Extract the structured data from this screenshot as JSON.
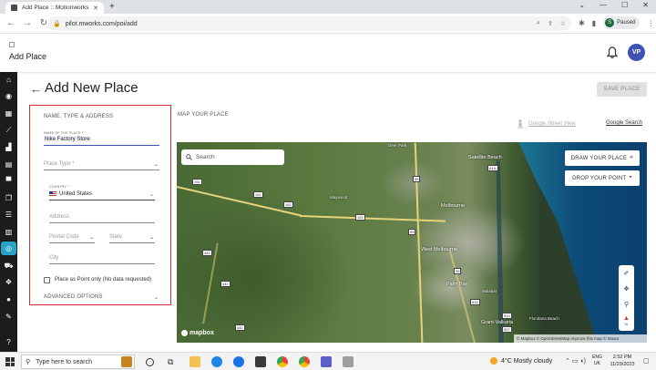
{
  "browser": {
    "tab_title": "Add Place :: Motionworks",
    "tab_close": "✕",
    "new_tab": "+",
    "url": "pilot.mworks.com/poi/add",
    "profile_initial": "S",
    "profile_status": "Paused"
  },
  "app": {
    "header_title": "Add Place",
    "avatar_initials": "VP"
  },
  "page": {
    "title": "Add New Place",
    "save_button": "SAVE PLACE"
  },
  "form": {
    "section_title": "NAME, TYPE & ADDRESS",
    "name_label": "NAME OF THE PLACE *",
    "name_value": "Nike Factory Store",
    "place_type_placeholder": "Place Type *",
    "country_label": "COUNTRY *",
    "country_value": "United States",
    "address_placeholder": "Address",
    "postal_code_placeholder": "Postal Code",
    "state_placeholder": "State",
    "city_placeholder": "City",
    "point_only_label": "Place as Point only (No data requested)",
    "advanced_options": "ADVANCED OPTIONS"
  },
  "map": {
    "section_label": "MAP YOUR PLACE",
    "street_view_link": "Google Street View",
    "google_search_link": "Google Search",
    "search_placeholder": "Search",
    "draw_place_button": "DRAW YOUR PLACE",
    "drop_point_button": "DROP YOUR POINT",
    "compass_label": "N",
    "mapbox_logo": "mapbox",
    "attribution": "© Mapbox © OpenStreetMap Improve this map © Maxar",
    "labels": {
      "satellite_beach": "Satellite Beach",
      "melbourne": "Melbourne",
      "west_melbourne": "West Melbourne",
      "palm_bay": "Palm Bay",
      "malabar": "Malabar",
      "grant_valkaria": "Grant-Valkaria",
      "floridana_beach": "Floridana Beach",
      "deer_park": "Deer Park",
      "maywood": "Maywood"
    },
    "shields": {
      "r192a": "192",
      "r192b": "192",
      "r192c": "192",
      "r192d": "192",
      "i95a": "95",
      "i95b": "95",
      "i95c": "95",
      "r441a": "441",
      "r441b": "441",
      "r441c": "441",
      "a1a": "A1A",
      "r516": "516",
      "x514": "514",
      "x507": "507"
    }
  },
  "taskbar": {
    "search_placeholder": "Type here to search",
    "weather": "4°C  Mostly cloudy",
    "lang_top": "ENG",
    "lang_bottom": "UK",
    "time": "2:52 PM",
    "date": "11/29/2023"
  },
  "colors": {
    "highlight_border": "#d32f2f",
    "active_sidebar": "#26a4c9",
    "avatar": "#3f51b5"
  }
}
